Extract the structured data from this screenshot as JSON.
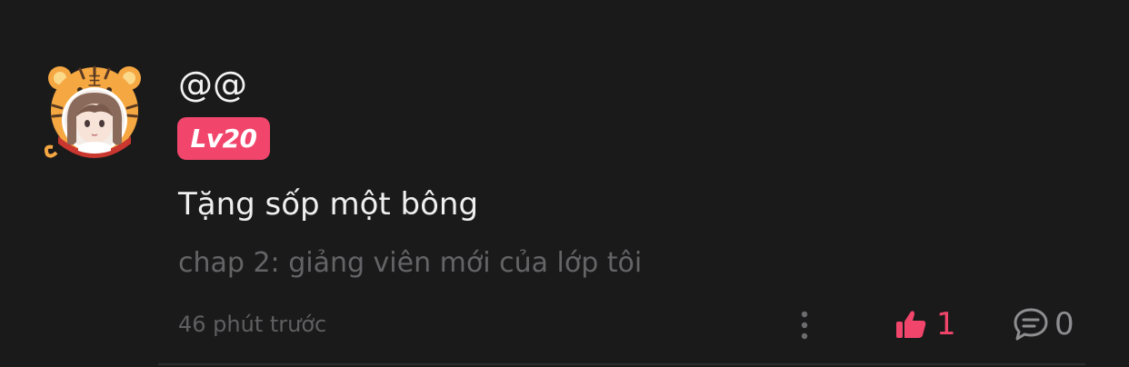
{
  "comment": {
    "username": "@@",
    "level": "Lv20",
    "text": "Tặng sốp một bông",
    "chapter": "chap 2: giảng viên mới của lớp tôi",
    "timestamp": "46 phút trước",
    "likes": "1",
    "replies": "0"
  },
  "colors": {
    "background": "#1b1a1b",
    "accent": "#f2456c",
    "muted": "#646466"
  },
  "icons": {
    "avatar_frame": "tiger-hood-avatar",
    "more": "more-vertical-icon",
    "like": "thumbs-up-icon",
    "reply": "comment-bubble-icon"
  }
}
